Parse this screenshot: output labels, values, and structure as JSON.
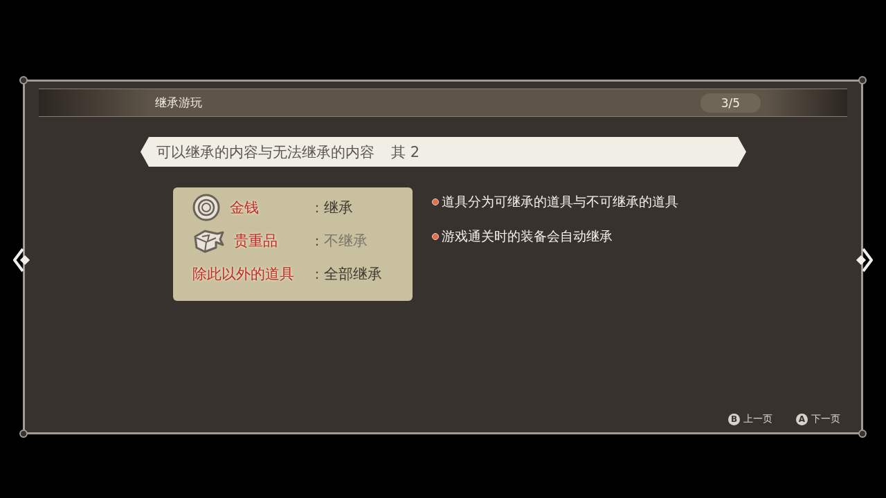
{
  "header": {
    "title": "继承游玩",
    "page": "3/5"
  },
  "banner": {
    "title": "可以继承的内容与无法继承的内容",
    "part": "其 2"
  },
  "items": [
    {
      "kind": "coin",
      "name": "金钱",
      "colon": "：",
      "value": "继承",
      "dimmed": false
    },
    {
      "kind": "chest",
      "name": "贵重品",
      "colon": "：",
      "value": "不继承",
      "dimmed": true
    },
    {
      "kind": "plain",
      "name": "除此以外的道具",
      "colon": "：",
      "value": "全部继承",
      "dimmed": false
    }
  ],
  "notes": [
    "道具分为可继承的道具与不可继承的道具",
    "游戏通关时的装备会自动继承"
  ],
  "footer": [
    {
      "key": "B",
      "label": "上一页"
    },
    {
      "key": "A",
      "label": "下一页"
    }
  ]
}
